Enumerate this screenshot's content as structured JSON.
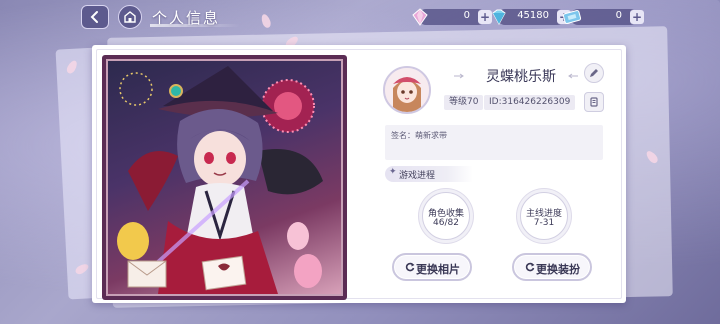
{
  "header": {
    "title": "个人信息"
  },
  "currencies": [
    {
      "icon": "pink-gem-icon",
      "value": "0"
    },
    {
      "icon": "blue-diamond-icon",
      "value": "45180"
    },
    {
      "icon": "ticket-icon",
      "value": "0"
    }
  ],
  "profile": {
    "name": "灵蝶桃乐斯",
    "level": "等级70",
    "id": "ID:316426226309",
    "signature": "签名：萌新求带"
  },
  "progress": {
    "section_title": "游戏进程",
    "character_collection_label": "角色收集",
    "character_collection_value": "46/82",
    "main_story_label": "主线进度",
    "main_story_value": "7-31"
  },
  "actions": {
    "change_photo": "更换相片",
    "change_outfit": "更换装扮"
  },
  "colors": {
    "accent": "#5d5a8e",
    "portrait_frame": "#5b2c54"
  }
}
